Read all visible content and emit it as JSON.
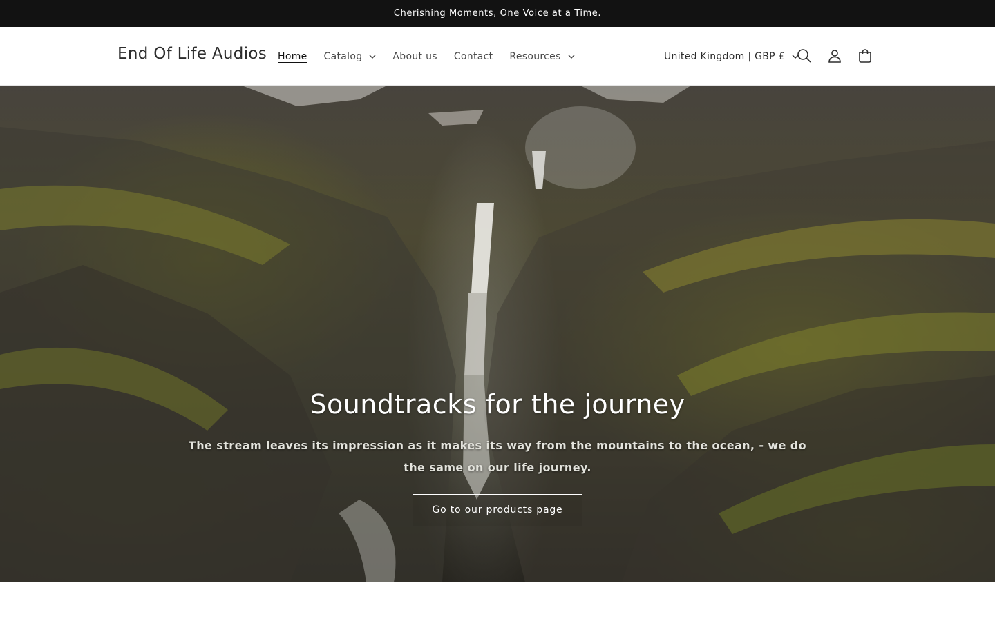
{
  "announcement": {
    "text": "Cherishing Moments, One Voice at a Time."
  },
  "header": {
    "logo": "End Of Life Audios",
    "nav": [
      {
        "label": "Home",
        "active": true,
        "dropdown": false
      },
      {
        "label": "Catalog",
        "active": false,
        "dropdown": true
      },
      {
        "label": "About us",
        "active": false,
        "dropdown": false
      },
      {
        "label": "Contact",
        "active": false,
        "dropdown": false
      },
      {
        "label": "Resources",
        "active": false,
        "dropdown": true
      }
    ],
    "country_selector": "United Kingdom | GBP £",
    "icons": [
      "search-icon",
      "account-icon",
      "cart-icon"
    ]
  },
  "hero": {
    "title": "Soundtracks for the journey",
    "subtitle": "The stream leaves its impression as it makes its way from the mountains to the ocean, - we do the same on our life journey.",
    "button_label": "Go to our products page"
  },
  "colors": {
    "announcement_bg": "#121212",
    "text_dark": "#121212",
    "hero_text": "#ffffff"
  }
}
